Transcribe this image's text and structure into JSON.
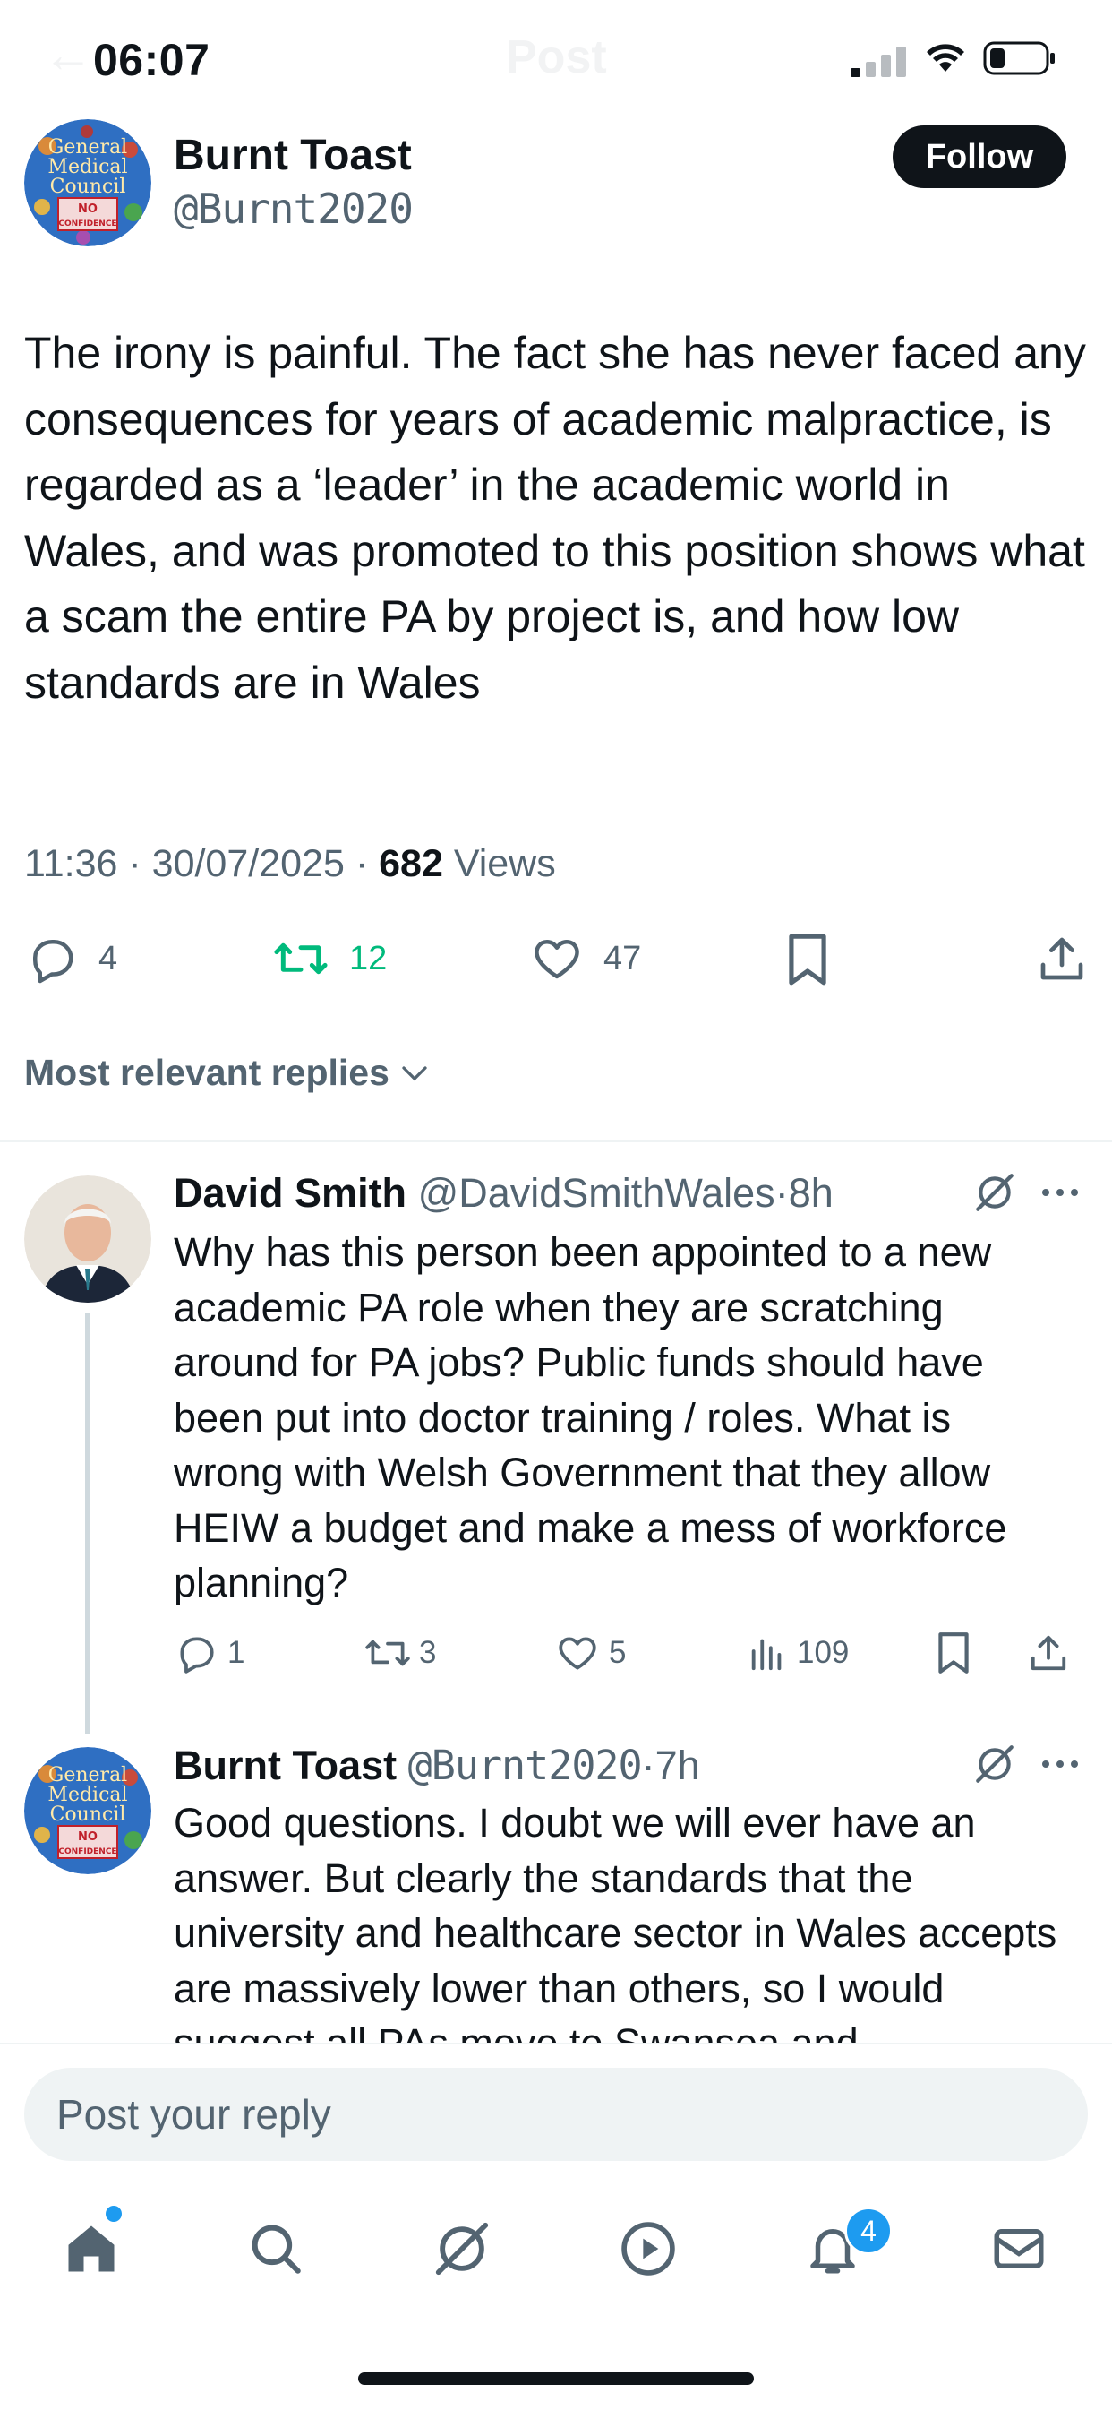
{
  "status_bar": {
    "time": "06:07"
  },
  "header": {
    "back_glyph": "←",
    "title": "Post"
  },
  "post": {
    "author_name": "Burnt Toast",
    "author_handle": "@Burnt2020",
    "follow_label": "Follow",
    "text": "The irony is painful. The fact she has never faced any consequences for years of academic malpractice, is regarded as a ‘leader’ in the academic world in Wales, and was promoted to this position shows what a scam the entire PA by project is, and how low standards are in Wales",
    "time": "11:36",
    "date": "30/07/2025",
    "views_count": "682",
    "views_label": "Views",
    "separator": "·",
    "stats": {
      "replies": "4",
      "reposts": "12",
      "likes": "47"
    }
  },
  "avatar_logo": {
    "line1": "General",
    "line2": "Medical",
    "line3": "Council",
    "line4": "NO",
    "line5": "CONFIDENCE"
  },
  "replies_filter": {
    "label": "Most relevant replies"
  },
  "replies": [
    {
      "name": "David Smith",
      "handle": "@DavidSmithWales",
      "age": "8h",
      "text": "Why has this person been appointed to a new academic PA role when they are scratching around for PA jobs? Public funds should have been put into doctor training / roles. What is wrong with Welsh Government that they allow HEIW a budget and make a mess of workforce planning?",
      "stats": {
        "replies": "1",
        "reposts": "3",
        "likes": "5",
        "views": "109"
      }
    },
    {
      "name": "Burnt Toast",
      "handle": "@Burnt2020",
      "age": "7h",
      "text": "Good questions. I doubt we will ever have an answer. But clearly the standards that the university and healthcare sector in Wales accepts are massively lower than others, so I would suggest all PAs move to Swansea and"
    }
  ],
  "compose": {
    "placeholder": "Post your reply"
  },
  "bottom_nav": {
    "items": [
      "home-icon",
      "search-icon",
      "grok-icon",
      "video-icon",
      "notifications-icon",
      "messages-icon"
    ],
    "notification_count": "4"
  },
  "colors": {
    "accent": "#1d9bf0",
    "repost_green": "#00ba7c",
    "text": "#0f1419",
    "secondary": "#536471"
  }
}
